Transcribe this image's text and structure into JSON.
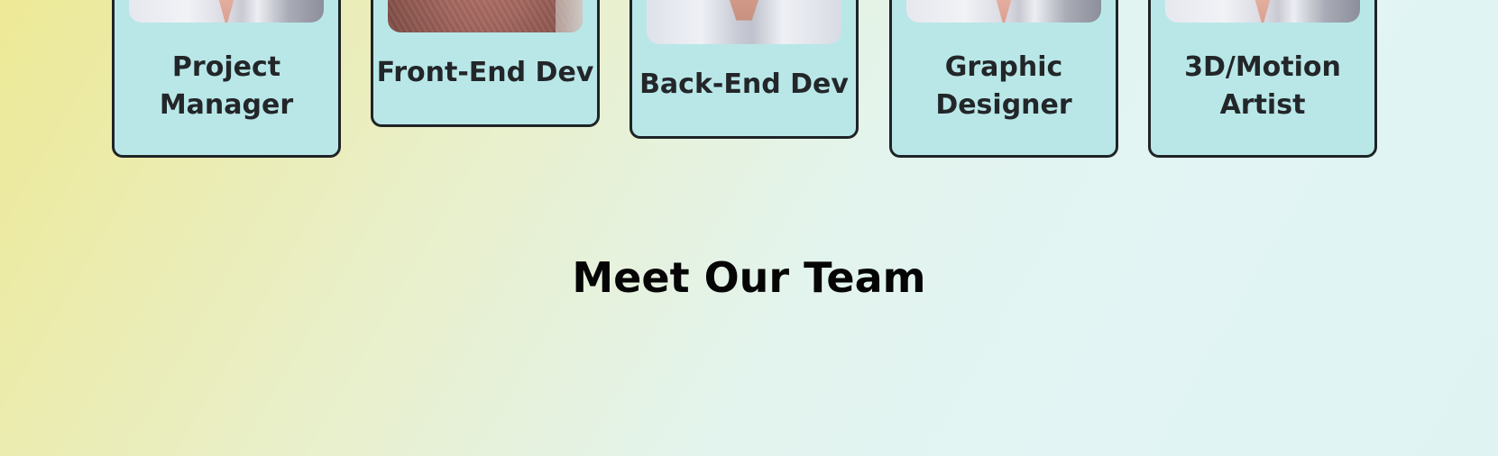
{
  "team": {
    "heading": "Meet Our Team",
    "cards": [
      {
        "role_lines": [
          "Project",
          "Manager"
        ],
        "photo": "man-white-shirt-photo"
      },
      {
        "role_lines": [
          "Front-End Dev"
        ],
        "photo": "woman-hijab-photo"
      },
      {
        "role_lines": [
          "Back-End Dev"
        ],
        "photo": "man-collared-shirt-photo"
      },
      {
        "role_lines": [
          "Graphic",
          "Designer"
        ],
        "photo": "man-white-shirt-photo"
      },
      {
        "role_lines": [
          "3D/Motion",
          "Artist"
        ],
        "photo": "man-white-shirt-photo"
      }
    ]
  },
  "colors": {
    "card_background": "#b9e7e8",
    "card_border": "#1f2326",
    "text": "#232629",
    "heading": "#050505"
  }
}
